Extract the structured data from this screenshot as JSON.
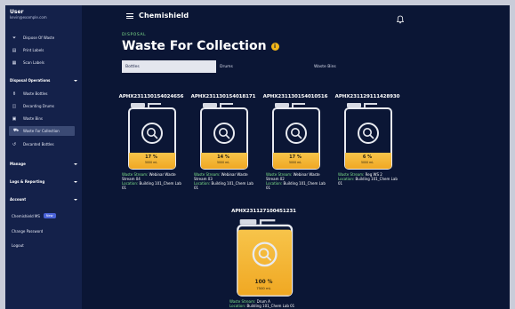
{
  "user": {
    "name": "User",
    "email": "kevin@example.com"
  },
  "sidebar": {
    "top_items": [
      {
        "label": "Dispose Of Waste",
        "icon": "funnel-icon"
      },
      {
        "label": "Print Labels",
        "icon": "printer-icon"
      },
      {
        "label": "Scan Labels",
        "icon": "qr-code-icon"
      }
    ],
    "disposal_section": "Disposal Operations",
    "disposal_items": [
      {
        "label": "Waste Bottles",
        "icon": "bottle-icon"
      },
      {
        "label": "Decanting Drums",
        "icon": "drum-icon"
      },
      {
        "label": "Waste Bins",
        "icon": "bin-icon"
      },
      {
        "label": "Waste For Collection",
        "icon": "truck-icon",
        "active": true
      },
      {
        "label": "Decanted Bottles",
        "icon": "undo-icon"
      }
    ],
    "sections": [
      "Manage",
      "Logs & Reporting",
      "Account"
    ],
    "ms_label": "Chemishield MS",
    "ms_badge": "New",
    "change_password": "Change Password",
    "logout": "Logout"
  },
  "header": {
    "app_name": "Chemishield"
  },
  "breadcrumb": "DISPOSAL",
  "page_title": "Waste For Collection",
  "tabs": [
    "Bottles",
    "Drums",
    "Waste Bins"
  ],
  "labels": {
    "stream": "Waste Stream:",
    "location": "Location:"
  },
  "colors": {
    "accent_green": "#7ee08a",
    "fill_orange": "#f3b72c",
    "background": "#0b1635"
  },
  "containers": [
    {
      "id": "APHX231130154024656",
      "percent_text": "17 %",
      "fill_fraction": 0.17,
      "volume": "5000 mL",
      "stream": "Webinar Waste Stream 04",
      "location": "Building 101_Chem Lab 01"
    },
    {
      "id": "APHX231130154018171",
      "percent_text": "14 %",
      "fill_fraction": 0.14,
      "volume": "5000 mL",
      "stream": "Webinar Waste Stream 03",
      "location": "Building 101_Chem Lab 01"
    },
    {
      "id": "APHX231130154010516",
      "percent_text": "17 %",
      "fill_fraction": 0.17,
      "volume": "5000 mL",
      "stream": "Webinar Waste Stream 02",
      "location": "Building 101_Chem Lab 01"
    },
    {
      "id": "APHX231129111428930",
      "percent_text": "6 %",
      "fill_fraction": 0.06,
      "volume": "5000 mL",
      "stream": "Reg WS 2",
      "location": "Building 101_Chem Lab 01"
    },
    {
      "id": "APHX231127100451231",
      "percent_text": "100 %",
      "fill_fraction": 1.0,
      "volume": "7500 mL",
      "stream": "Drum A",
      "location": "Building 101_Chem Lab 01"
    }
  ]
}
